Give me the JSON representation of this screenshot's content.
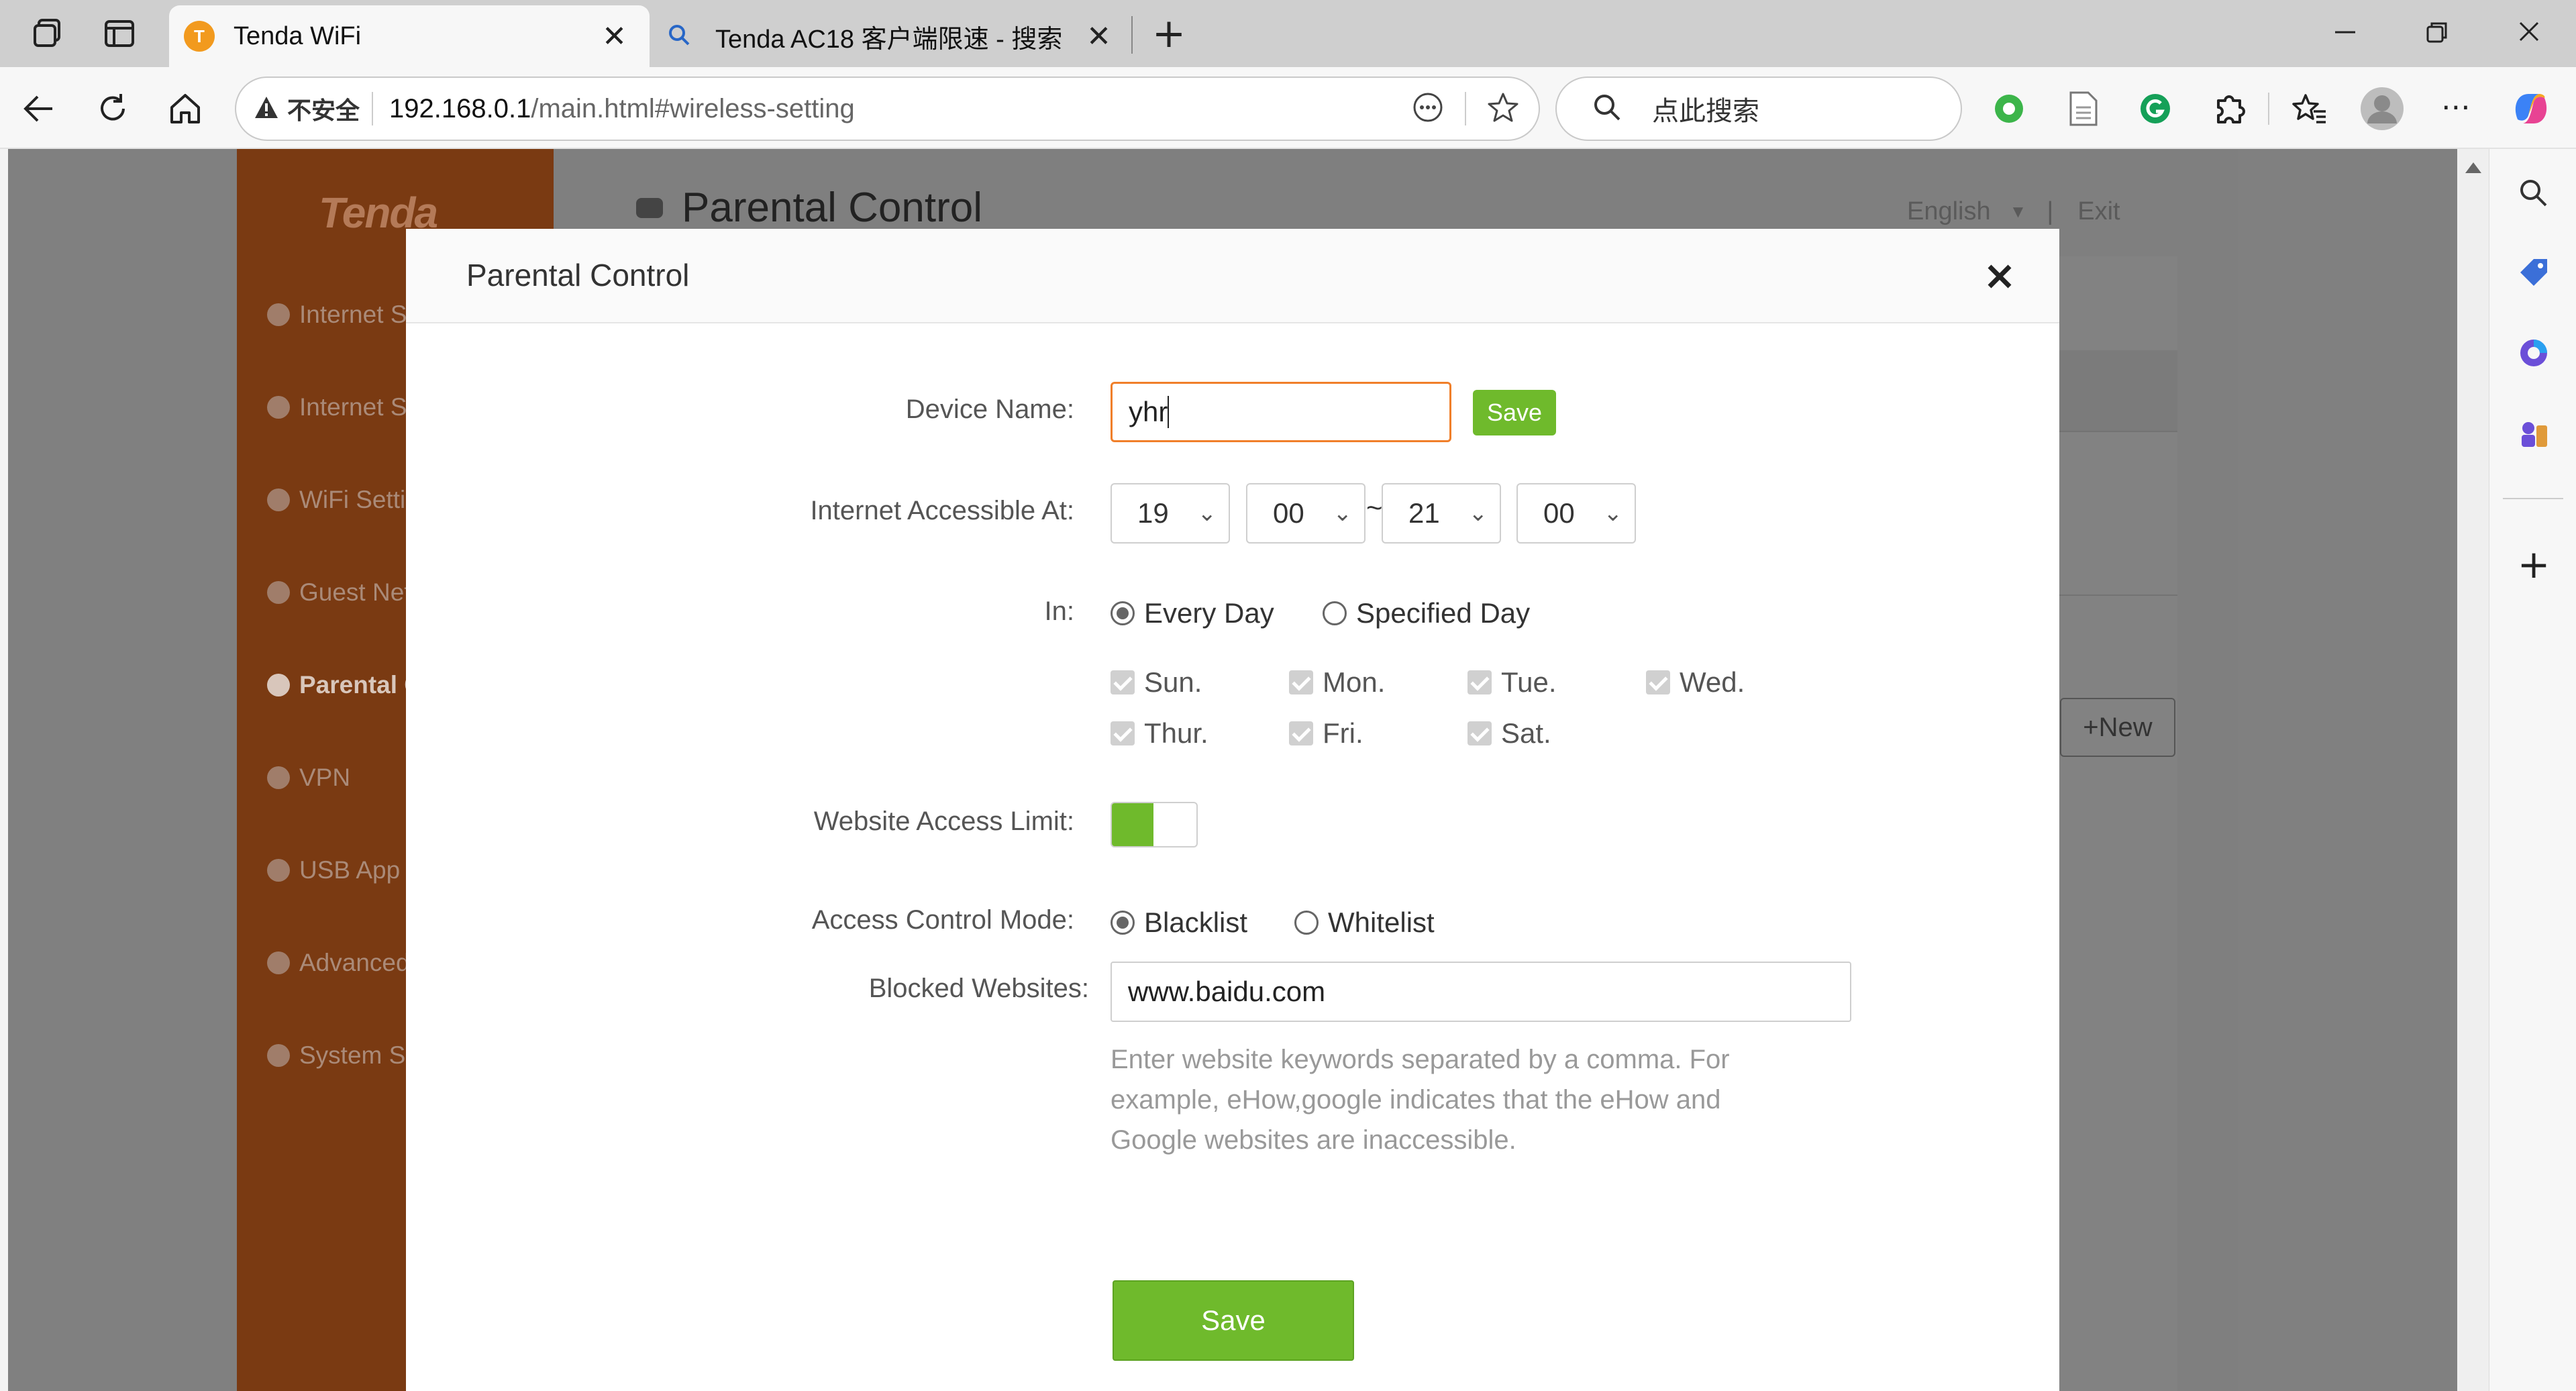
{
  "browser": {
    "tabs": [
      {
        "title": "Tenda WiFi",
        "active": true
      },
      {
        "title": "Tenda AC18 客户端限速 - 搜索",
        "active": false
      }
    ],
    "security_label": "不安全",
    "url_host": "192.168.0.1",
    "url_path": "/main.html#wireless-setting",
    "search_placeholder": "点此搜索"
  },
  "router": {
    "logo": "Tenda",
    "page_title": "Parental Control",
    "language": "English",
    "exit": "Exit",
    "new_button": "+New",
    "sidebar": [
      {
        "label": "Internet Status",
        "active": false
      },
      {
        "label": "Internet Settings",
        "active": false
      },
      {
        "label": "WiFi Settings",
        "active": false
      },
      {
        "label": "Guest Network",
        "active": false
      },
      {
        "label": "Parental Control",
        "active": true
      },
      {
        "label": "VPN",
        "active": false
      },
      {
        "label": "USB App",
        "active": false
      },
      {
        "label": "Advanced",
        "active": false
      },
      {
        "label": "System Settings",
        "active": false
      }
    ]
  },
  "modal": {
    "title": "Parental Control",
    "close": "×",
    "device_name_label": "Device Name:",
    "device_name_value": "yhr",
    "device_save": "Save",
    "access_label": "Internet Accessible At:",
    "time_start_hour": "19",
    "time_start_min": "00",
    "time_sep": "~",
    "time_end_hour": "21",
    "time_end_min": "00",
    "in_label": "In:",
    "every_day": "Every Day",
    "specified_day": "Specified Day",
    "schedule_mode": "Every Day",
    "days": [
      "Sun.",
      "Mon.",
      "Tue.",
      "Wed.",
      "Thur.",
      "Fri.",
      "Sat."
    ],
    "website_limit_label": "Website Access Limit:",
    "website_limit_on": true,
    "mode_label": "Access Control Mode:",
    "blacklist": "Blacklist",
    "whitelist": "Whitelist",
    "access_mode": "Blacklist",
    "blocked_label": "Blocked Websites:",
    "blocked_value": "www.baidu.com",
    "hint_line1": "Enter website keywords separated by a comma. For",
    "hint_line2": "example, eHow,google indicates that the eHow and",
    "hint_line3": "Google websites are inaccessible.",
    "save_button": "Save"
  },
  "colors": {
    "accent_green": "#6fba2c",
    "input_focus": "#f07f2a",
    "sidebar": "#7a3a12"
  }
}
